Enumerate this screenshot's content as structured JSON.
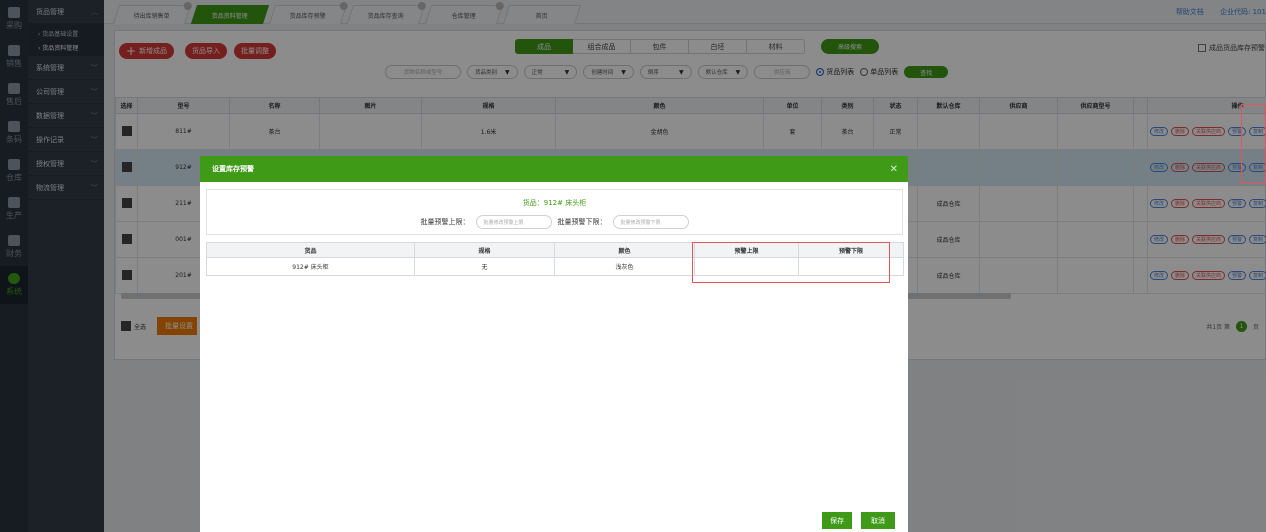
{
  "rail": [
    {
      "label": "采购",
      "icon": "cart-icon"
    },
    {
      "label": "销售",
      "icon": "barcode-icon"
    },
    {
      "label": "售后",
      "icon": "grid-icon"
    },
    {
      "label": "条码",
      "icon": "barcode2-icon"
    },
    {
      "label": "仓库",
      "icon": "warehouse-icon"
    },
    {
      "label": "生产",
      "icon": "robot-arm-icon"
    },
    {
      "label": "财务",
      "icon": "calculator-icon"
    },
    {
      "label": "系统",
      "icon": "gear-icon"
    }
  ],
  "menu": {
    "groups": [
      {
        "label": "货品管理",
        "sub": [
          "› 货品基础设置",
          "› 货品资料管理"
        ]
      },
      {
        "label": "系统管理"
      },
      {
        "label": "公司管理"
      },
      {
        "label": "数据管理"
      },
      {
        "label": "操作记录"
      },
      {
        "label": "授权管理"
      },
      {
        "label": "物流管理"
      }
    ]
  },
  "tabs": [
    "待出库销售单",
    "货品资料管理",
    "货品库存预警",
    "货品库存查询",
    "仓库管理",
    "首页"
  ],
  "toplinks": {
    "help": "帮助文档",
    "company": "企业代码: 101"
  },
  "toolbar": {
    "add": "新增成品",
    "import": "货品导入",
    "batch_adjust": "批量调整",
    "segments": [
      "成品",
      "组合成品",
      "包件",
      "白坯",
      "材料"
    ],
    "advanced": "高级搜索",
    "stock_alert_check": "成品货品库存预警"
  },
  "filters": {
    "search_placeholder": "货物名称或型号",
    "category": "货品类别",
    "status": "正常",
    "created": "创建时间",
    "order": "倒序",
    "warehouse": "默认仓库",
    "supplier_placeholder": "供应商",
    "radio_goods": "货品列表",
    "radio_single": "单品列表",
    "query": "查找"
  },
  "table": {
    "headers": [
      "选择",
      "型号",
      "名称",
      "图片",
      "规格",
      "颜色",
      "单位",
      "类别",
      "状态",
      "默认仓库",
      "供应商",
      "供应商型号",
      "",
      "操作"
    ],
    "rows": [
      {
        "model": "811#",
        "name": "茶台",
        "spec": "1.6米",
        "color": "金胡色",
        "unit": "套",
        "cat": "茶台",
        "status": "正常",
        "wh": ""
      },
      {
        "model": "912#",
        "name": "",
        "spec": "",
        "color": "",
        "unit": "",
        "cat": "",
        "status": "",
        "wh": ""
      },
      {
        "model": "211#",
        "name": "",
        "spec": "",
        "color": "",
        "unit": "",
        "cat": "",
        "status": "",
        "wh": "成品仓库"
      },
      {
        "model": "001#",
        "name": "",
        "spec": "",
        "color": "",
        "unit": "",
        "cat": "",
        "status": "",
        "wh": "成品仓库"
      },
      {
        "model": "201#",
        "name": "",
        "spec": "",
        "color": "",
        "unit": "",
        "cat": "",
        "status": "",
        "wh": "成品仓库"
      }
    ],
    "ops": {
      "edit": "修改",
      "delete": "删除",
      "link_supplier": "关联供应商",
      "alert": "预警",
      "copy": "复制"
    }
  },
  "footer": {
    "select_all": "全选",
    "batch_set": "批量设置",
    "pager_total": "共1页 第",
    "page": "1",
    "page_suffix": "页"
  },
  "modal": {
    "title": "设置库存预警",
    "goods_line": "货品：912# 床头柜",
    "upper_label": "批量预警上限：",
    "upper_placeholder": "批量修改预警上限",
    "lower_label": "批量预警下限：",
    "lower_placeholder": "批量修改预警下限",
    "headers": [
      "货品",
      "规格",
      "颜色",
      "预警上限",
      "预警下限"
    ],
    "row": {
      "goods": "912# 床头柜",
      "spec": "无",
      "color": "浅灰色",
      "upper": "",
      "lower": ""
    },
    "save": "保存",
    "cancel": "取消"
  }
}
